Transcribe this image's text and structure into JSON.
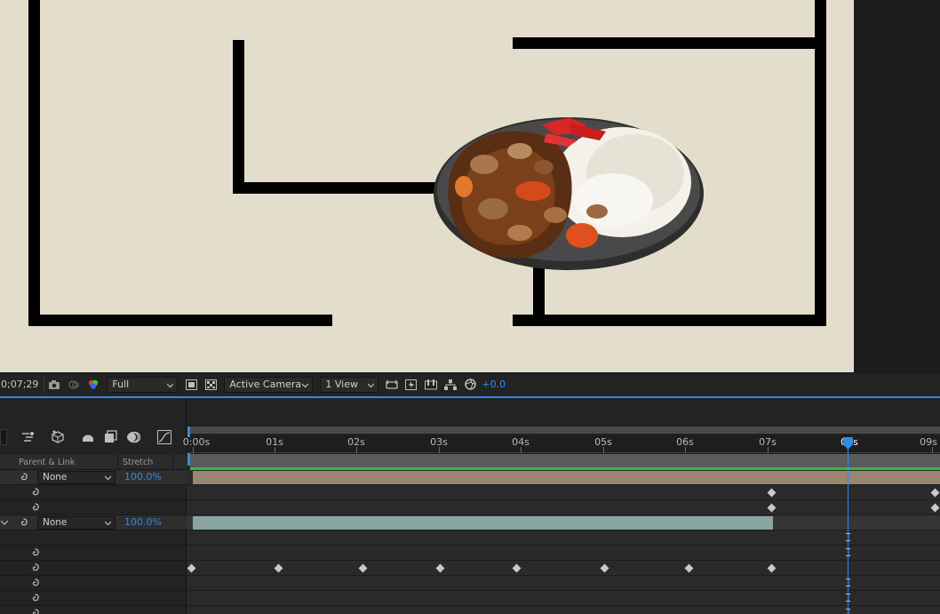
{
  "viewer": {
    "timecode": "0;07;29",
    "resolution": "Full",
    "camera": "Active Camera",
    "views": "1 View",
    "exposure": "+0.0",
    "colors": {
      "canvas": "#e2decb",
      "maze_wall": "#000000"
    }
  },
  "timeline": {
    "columns": {
      "parent": "Parent & Link",
      "stretch": "Stretch"
    },
    "ruler_ticks": [
      "0:00s",
      "01s",
      "02s",
      "03s",
      "04s",
      "05s",
      "06s",
      "07s",
      "08s",
      "09s"
    ],
    "current_time_label": "08s",
    "layers": [
      {
        "parent": "None",
        "stretch": "100.0%",
        "bar_color": "#9a8472"
      },
      {
        "parent": "None",
        "stretch": "100.0%",
        "bar_color": "#8aa5a1"
      }
    ],
    "accent": "#2d8ceb"
  }
}
